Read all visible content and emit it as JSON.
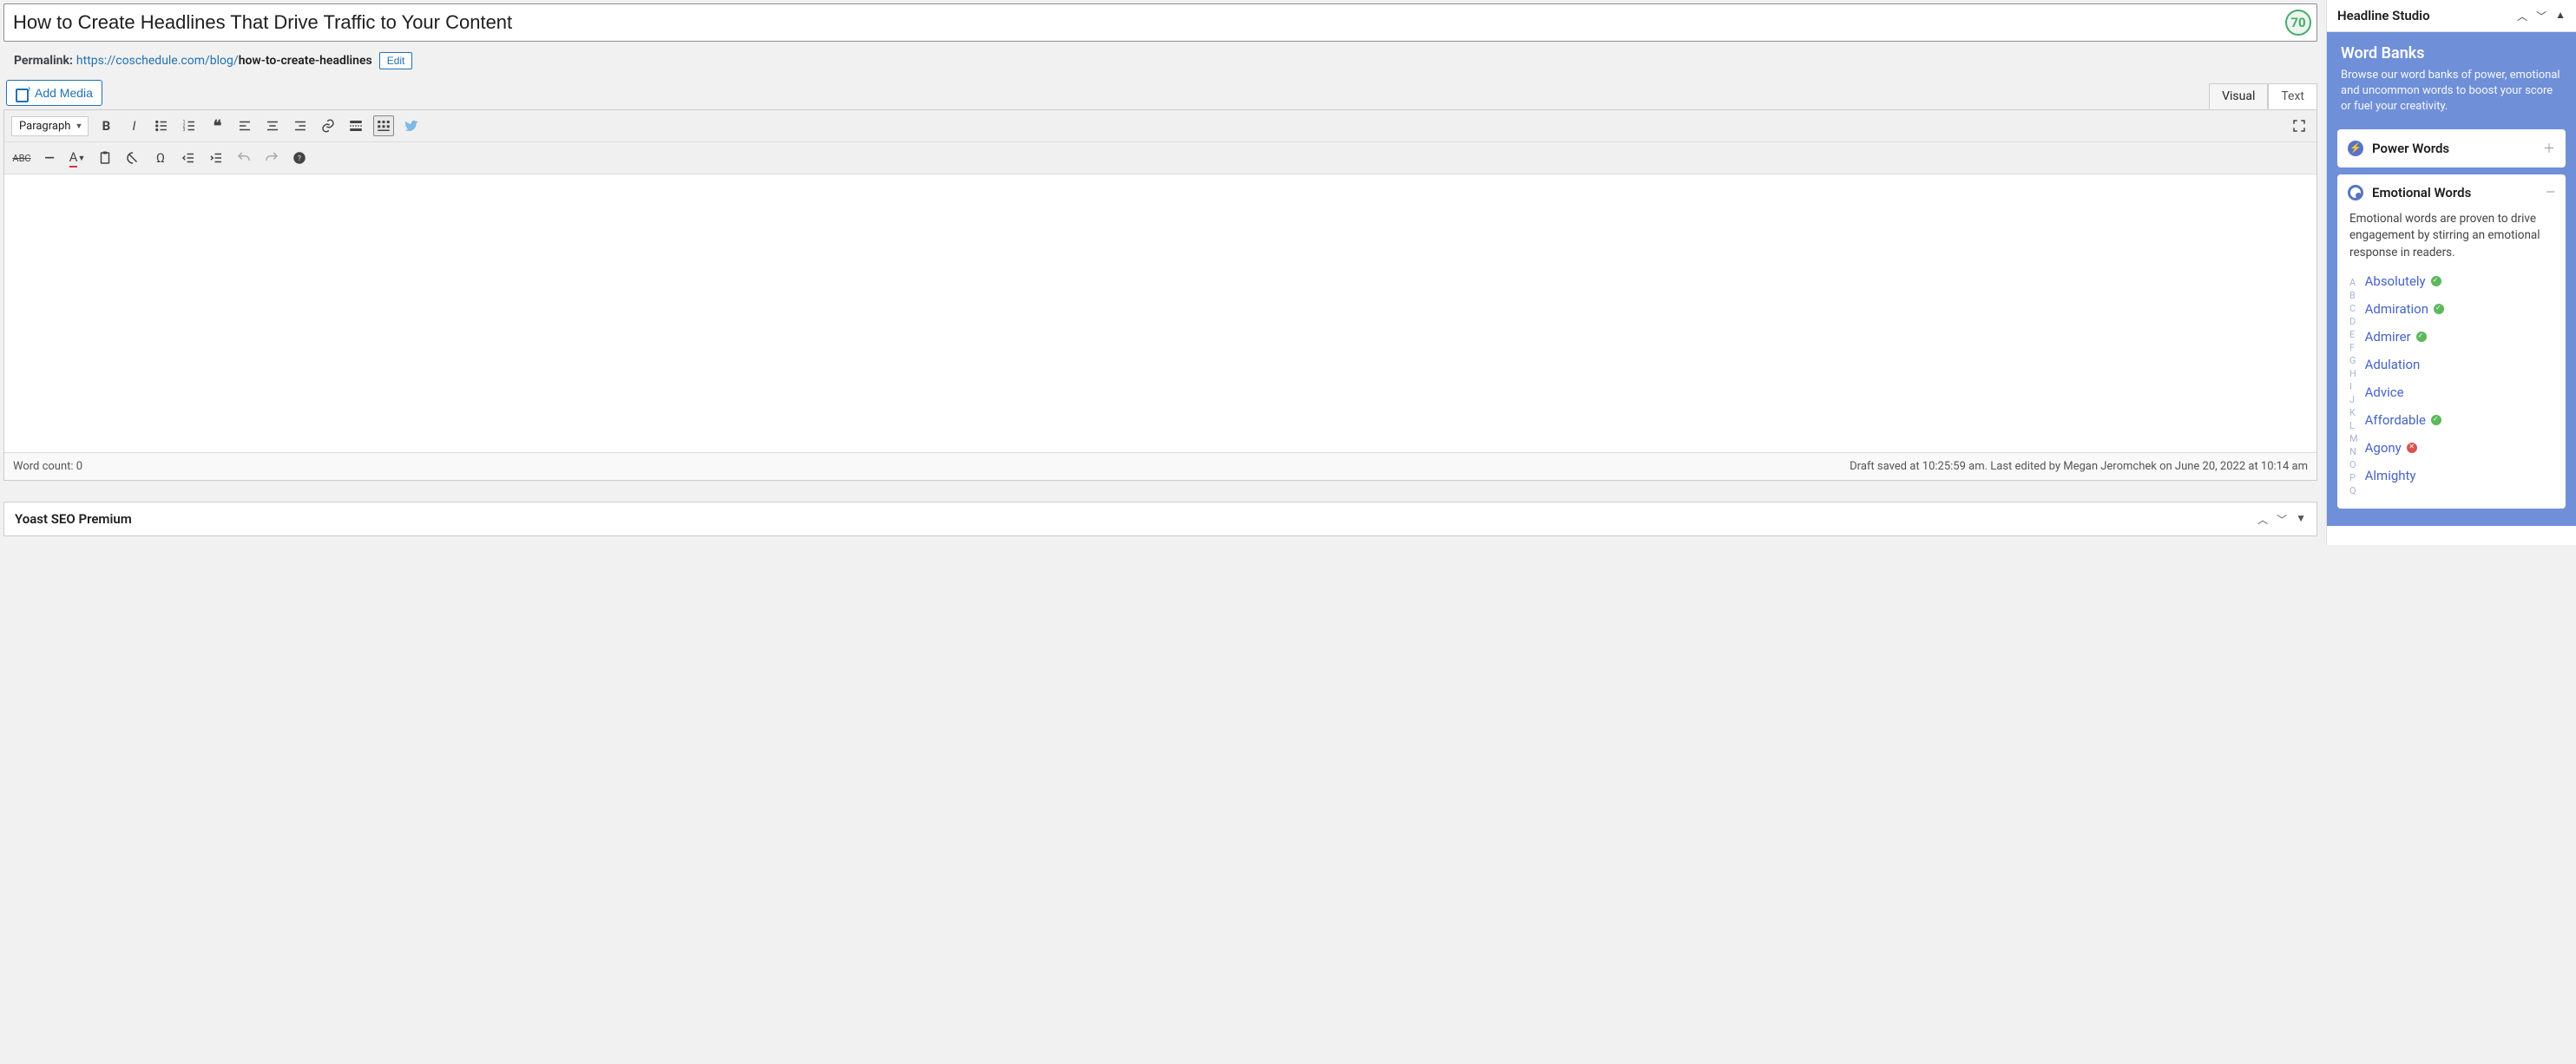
{
  "title": "How to Create Headlines That Drive Traffic to Your Content",
  "score": "70",
  "permalink": {
    "label": "Permalink:",
    "base": "https://coschedule.com/blog/",
    "slug": "how-to-create-headlines",
    "edit_label": "Edit"
  },
  "buttons": {
    "add_media": "Add Media"
  },
  "editor_tabs": {
    "visual": "Visual",
    "text": "Text"
  },
  "format_select": "Paragraph",
  "status": {
    "word_count_label": "Word count:",
    "word_count_value": "0",
    "save_info": "Draft saved at 10:25:59 am. Last edited by Megan Jeromchek on June 20, 2022 at 10:14 am"
  },
  "yoast": {
    "title": "Yoast SEO Premium"
  },
  "headline_studio": {
    "title": "Headline Studio",
    "word_banks": {
      "heading": "Word Banks",
      "sub": "Browse our word banks of power, emotional and uncommon words to boost your score or fuel your creativity."
    },
    "power_words": {
      "label": "Power Words"
    },
    "emotional_words": {
      "label": "Emotional Words",
      "desc": "Emotional words are proven to drive engagement by stirring an emotional response in readers."
    },
    "alpha": [
      "A",
      "B",
      "C",
      "D",
      "E",
      "F",
      "G",
      "H",
      "I",
      "J",
      "K",
      "L",
      "M",
      "N",
      "O",
      "P",
      "Q"
    ],
    "words": [
      {
        "t": "Absolutely",
        "s": "g"
      },
      {
        "t": "Admiration",
        "s": "g"
      },
      {
        "t": "Admirer",
        "s": "g"
      },
      {
        "t": "Adulation",
        "s": ""
      },
      {
        "t": "Advice",
        "s": ""
      },
      {
        "t": "Affordable",
        "s": "g"
      },
      {
        "t": "Agony",
        "s": "r"
      },
      {
        "t": "Almighty",
        "s": ""
      }
    ]
  }
}
